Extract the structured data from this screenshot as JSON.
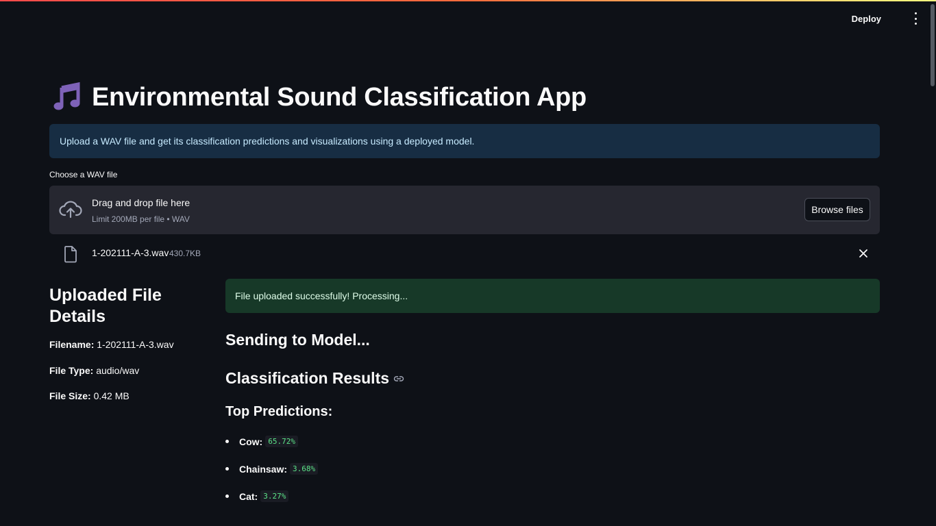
{
  "header": {
    "deploy_label": "Deploy",
    "menu_icon": "kebab-menu-icon",
    "accent_gradient": [
      "#ff4b4b",
      "#fffd80"
    ]
  },
  "app": {
    "title_icon": "musical-notes-icon",
    "title": "Environmental Sound Classification App",
    "info_text": "Upload a WAV file and get its classification predictions and visualizations using a deployed model."
  },
  "uploader": {
    "label": "Choose a WAV file",
    "drag_text": "Drag and drop file here",
    "limit_text": "Limit 200MB per file • WAV",
    "browse_label": "Browse files",
    "file": {
      "name": "1-202111-A-3.wav",
      "size": "430.7KB"
    }
  },
  "details": {
    "heading": "Uploaded File Details",
    "filename_label": "Filename:",
    "filename_value": "1-202111-A-3.wav",
    "type_label": "File Type:",
    "type_value": "audio/wav",
    "size_label": "File Size:",
    "size_value": "0.42 MB"
  },
  "results": {
    "success_text": "File uploaded successfully! Processing...",
    "sending_heading": "Sending to Model...",
    "results_heading": "Classification Results",
    "top_heading": "Top Predictions:",
    "predictions": [
      {
        "label": "Cow:",
        "pct": "65.72%"
      },
      {
        "label": "Chainsaw:",
        "pct": "3.68%"
      },
      {
        "label": "Cat:",
        "pct": "3.27%"
      }
    ]
  },
  "colors": {
    "background": "#0e1117",
    "info_bg": "#172d43",
    "success_bg": "#173928",
    "code_green": "#5ce488"
  }
}
